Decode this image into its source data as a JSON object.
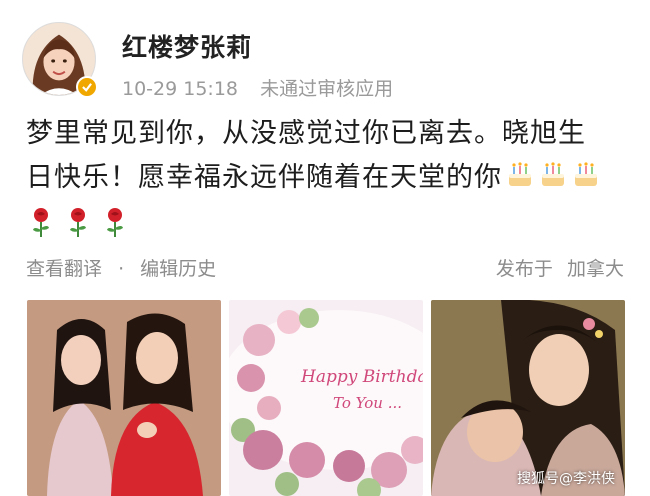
{
  "post": {
    "username": "红楼梦张莉",
    "timestamp": "10-29 15:18",
    "status": "未通过审核应用",
    "text_line1": "梦里常见到你，从没感觉过你已离去。晓旭生",
    "text_line2": "日快乐！愿幸福永远伴随着在天堂的你",
    "actions": {
      "view_translation": "查看翻译",
      "separator": "·",
      "edit_history": "编辑历史",
      "published_from": "发布于",
      "location": "加拿大"
    }
  },
  "photos": {
    "photo3_watermark": "搜狐号@李洪侠",
    "photo2_cake_text1": "Happy Birthday",
    "photo2_cake_text2": "To You ..."
  },
  "colors": {
    "verified_badge": "#f0a800",
    "meta_text": "#9a9a9a",
    "action_text": "#8c8c8c"
  },
  "icons": [
    "avatar",
    "verified-badge-icon",
    "birthday-cake-icon",
    "rose-icon"
  ]
}
